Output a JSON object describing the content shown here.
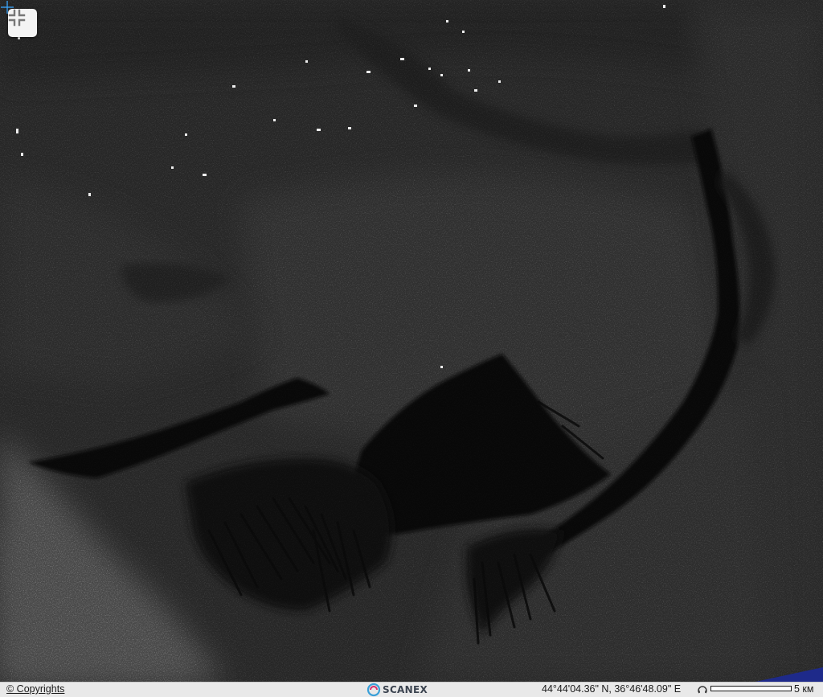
{
  "map": {
    "imagery": "SAR satellite radar image of sea surface with dark oil-slick patterns",
    "colors": {
      "sea": "#4b4b4b",
      "slick": "#0c0c0c",
      "ship": "#ffffff",
      "crosshair": "#3aa7ff"
    }
  },
  "controls": {
    "exit_fullscreen_icon": "exit-fullscreen-icon"
  },
  "status_bar": {
    "copyright_label": "© Copyrights",
    "logo_text": "SCANEX",
    "coordinates": "44°44'04.36\" N, 36°46'48.09\" E",
    "scale_label": "5 км"
  }
}
